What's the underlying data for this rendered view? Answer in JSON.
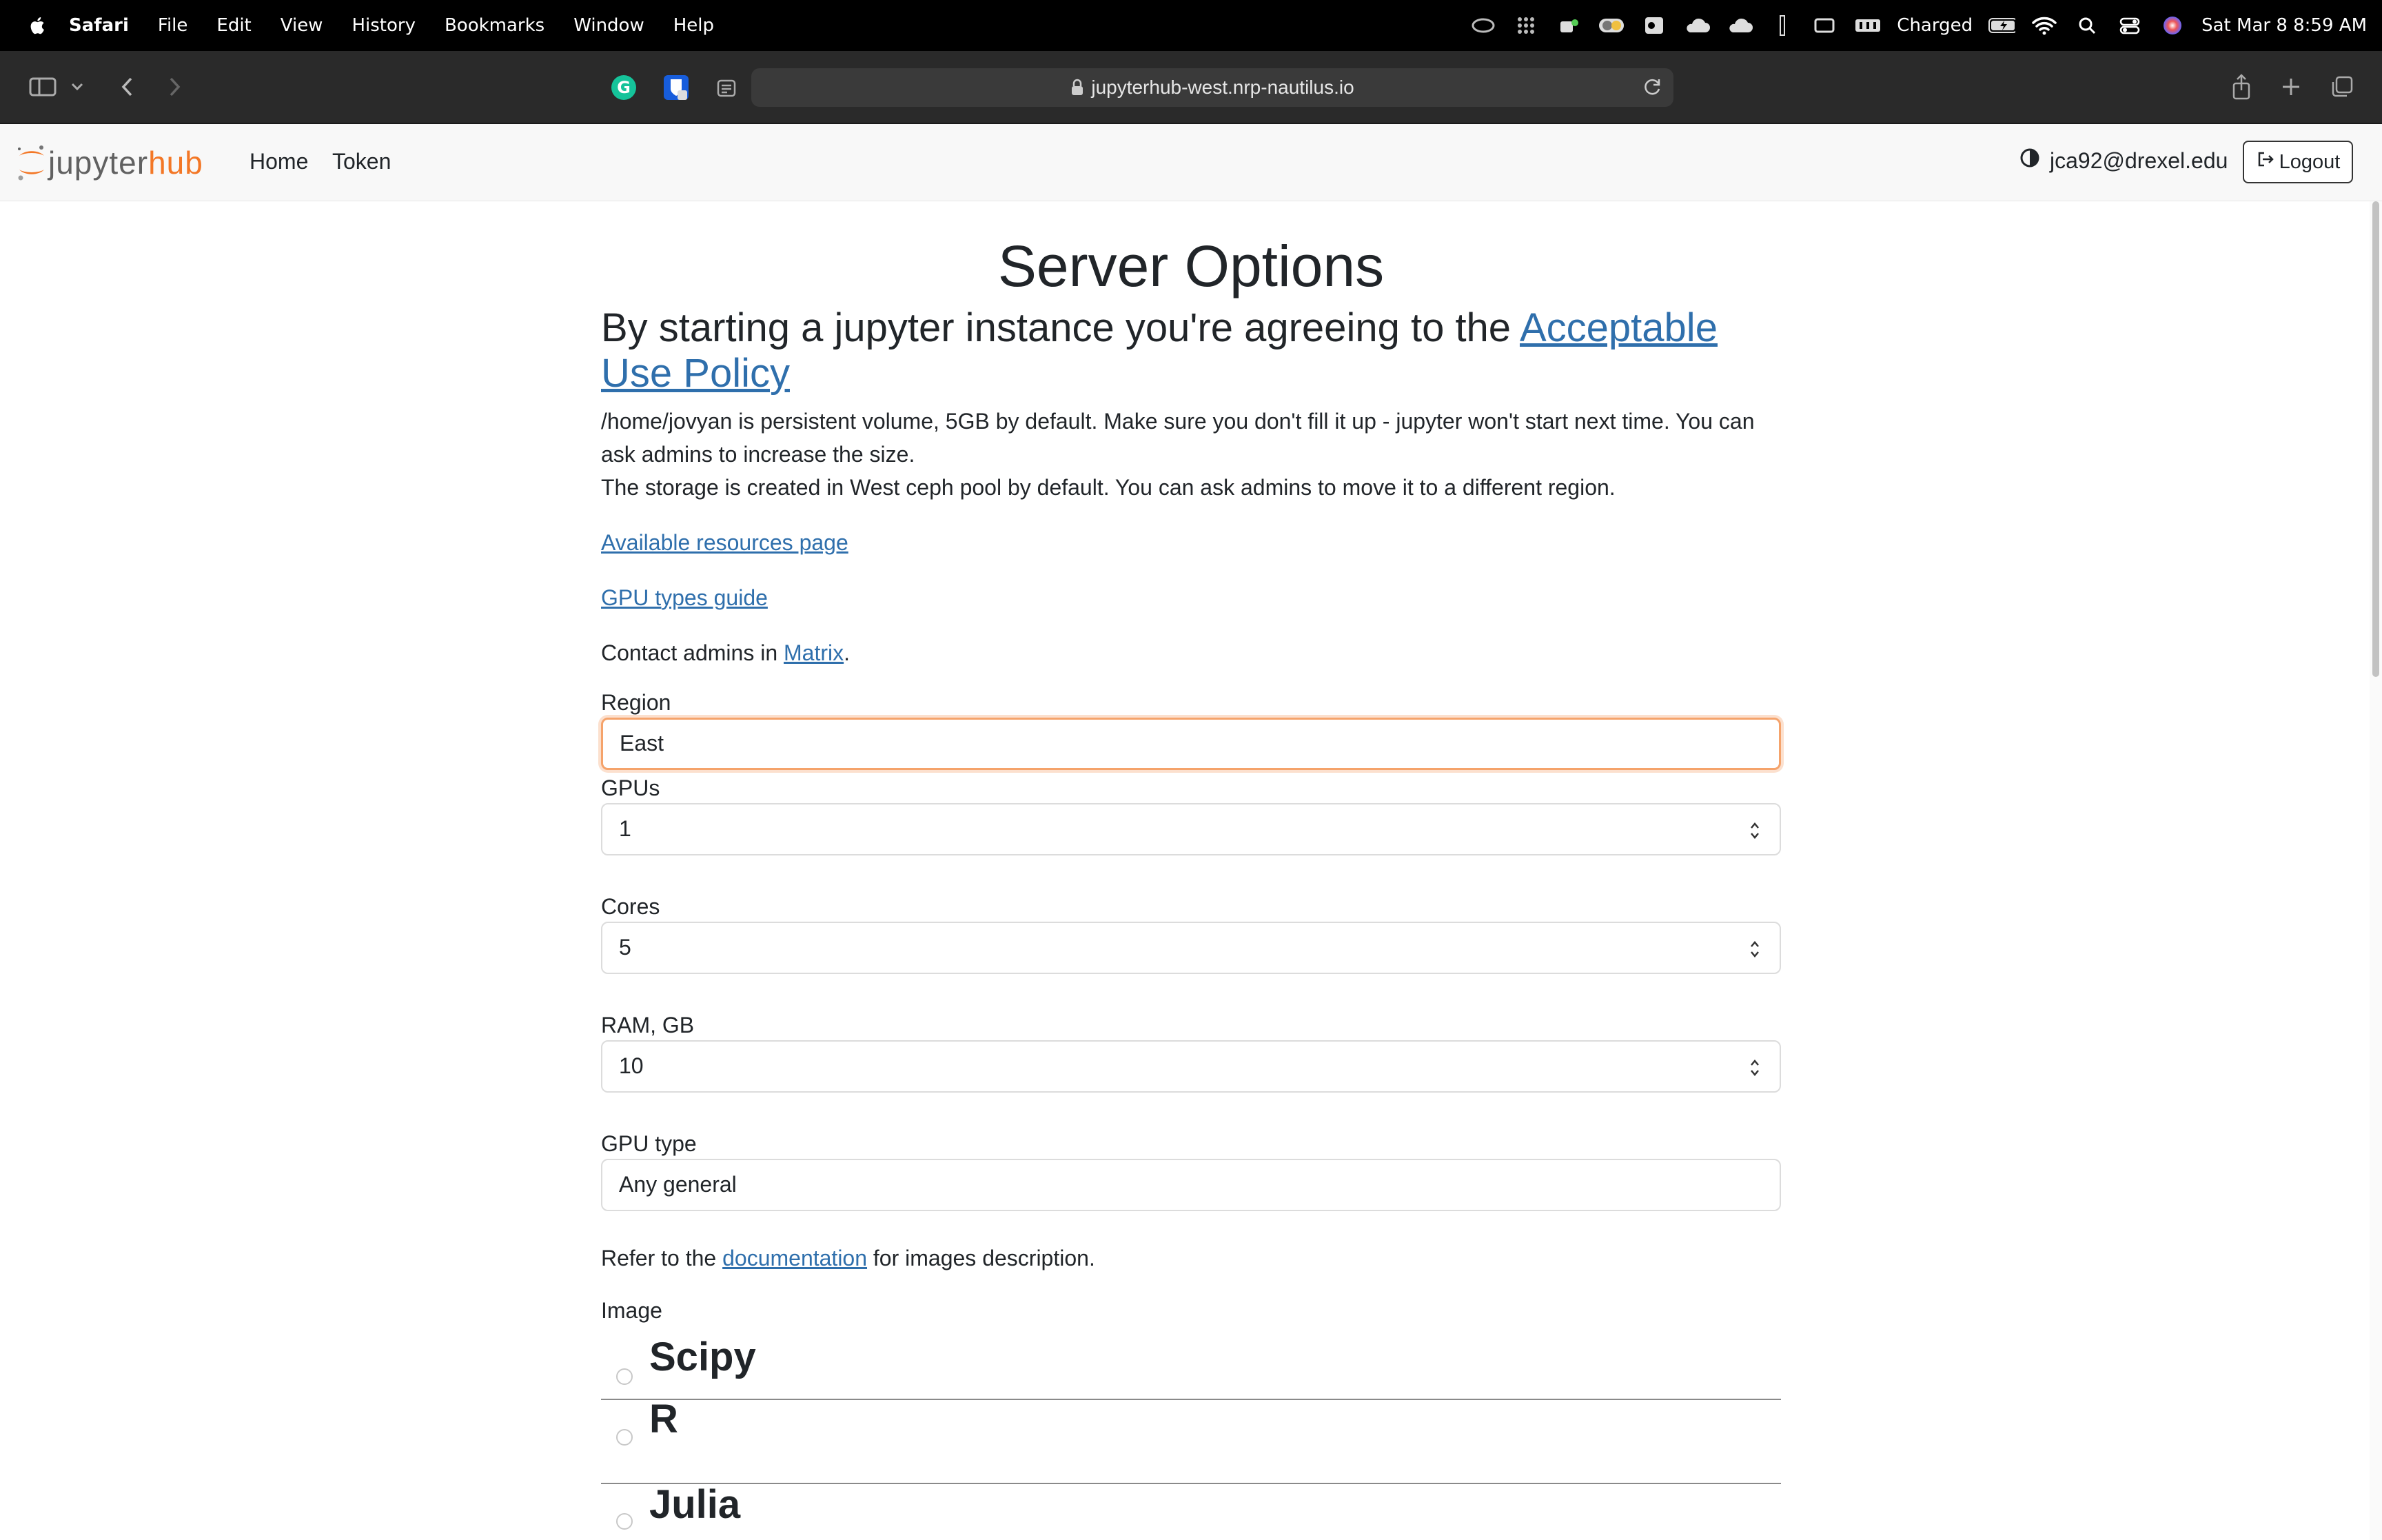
{
  "menubar": {
    "app": "Safari",
    "items": [
      "File",
      "Edit",
      "View",
      "History",
      "Bookmarks",
      "Window",
      "Help"
    ],
    "battery_text": "Charged",
    "datetime": "Sat Mar 8  8:59 AM"
  },
  "browser": {
    "url": "jupyterhub-west.nrp-nautilus.io"
  },
  "navbar": {
    "logo_part1": "jupyter",
    "logo_part2": "hub",
    "home": "Home",
    "token": "Token",
    "user": "jca92@drexel.edu",
    "logout": "Logout"
  },
  "page": {
    "title": "Server Options",
    "agree_text": "By starting a jupyter instance you're agreeing to the ",
    "agree_link": "Acceptable Use Policy",
    "storage_line1": "/home/jovyan is persistent volume, 5GB by default. Make sure you don't fill it up - jupyter won't start next time. You can ask admins to increase the size.",
    "storage_line2": "The storage is created in West ceph pool by default. You can ask admins to move it to a different region.",
    "resources_link": "Available resources page",
    "gpu_guide_link": "GPU types guide",
    "contact_prefix": "Contact admins in ",
    "contact_link": "Matrix",
    "contact_suffix": ".",
    "region_label": "Region",
    "region_value": "East",
    "gpus_label": "GPUs",
    "gpus_value": "1",
    "cores_label": "Cores",
    "cores_value": "5",
    "ram_label": "RAM, GB",
    "ram_value": "10",
    "gpu_type_label": "GPU type",
    "gpu_type_value": "Any general",
    "refer_prefix": "Refer to the ",
    "refer_link": "documentation",
    "refer_suffix": " for images description.",
    "image_label": "Image",
    "images": [
      "Scipy",
      "R",
      "Julia"
    ]
  },
  "colors": {
    "menubar_bg": "#000000",
    "toolbar_bg": "#2a2a2a",
    "link": "#2f6fac",
    "jupyter_orange": "#f37726",
    "focus_ring": "#f5a36b"
  }
}
